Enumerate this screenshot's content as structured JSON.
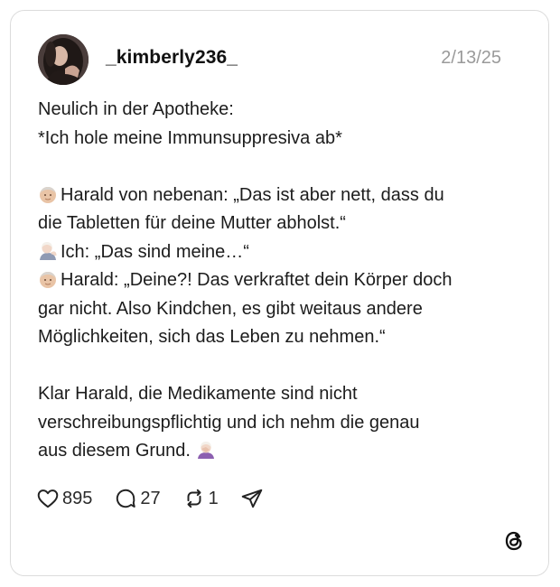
{
  "post": {
    "username": "_kimberly236_",
    "date": "2/13/25",
    "lines": [
      "Neulich in der Apotheke:",
      "*Ich hole meine Immunsuppresiva ab*",
      "",
      "Harald von nebenan: „Das ist aber nett, dass du",
      "die Tabletten für deine Mutter abholst.“",
      "Ich: „Das sind meine…“",
      "Harald: „Deine?! Das verkraftet dein Körper doch",
      "gar nicht. Also Kindchen, es gibt weitaus andere",
      "Möglichkeiten, sich das Leben zu nehmen.“",
      "",
      "Klar Harald, die Medikamente sind nicht",
      "verschreibungspflichtig und ich nehm die genau",
      "aus diesem Grund."
    ],
    "emojis": {
      "harald": "old-man-emoji",
      "me": "woman-tipping-hand-emoji",
      "facepalm": "woman-facepalming-emoji"
    }
  },
  "actions": {
    "likes": "895",
    "replies": "27",
    "reposts": "1",
    "like_icon": "heart-icon",
    "reply_icon": "comment-icon",
    "repost_icon": "repost-icon",
    "share_icon": "send-icon"
  },
  "brand": {
    "logo": "threads-logo-icon"
  },
  "colors": {
    "text": "#1c1c1c",
    "muted": "#9a9a9a",
    "border": "#dcdcdc"
  }
}
